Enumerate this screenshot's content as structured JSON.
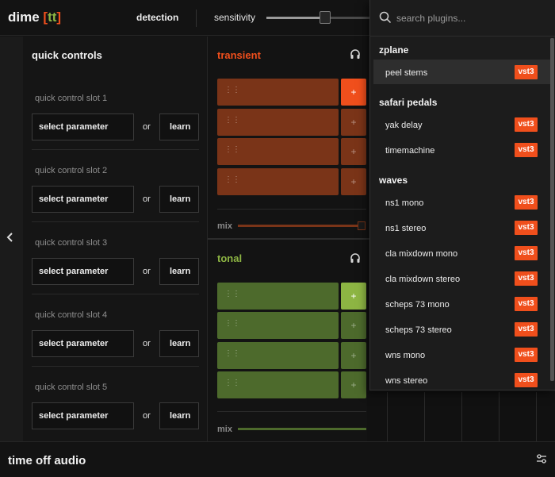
{
  "header": {
    "logo": {
      "name": "dime",
      "open": "[",
      "tt": "tt",
      "close": "]"
    },
    "detection_tab": "detection",
    "sensitivity_label": "sensitivity",
    "sensitivity_value": 0.56
  },
  "left_strip": {
    "collapse_icon": "chevron-left-icon"
  },
  "quick_controls": {
    "title": "quick controls",
    "or_text": "or",
    "slots": [
      {
        "label": "quick control slot 1",
        "param": "select parameter",
        "learn": "learn"
      },
      {
        "label": "quick control slot 2",
        "param": "select parameter",
        "learn": "learn"
      },
      {
        "label": "quick control slot 3",
        "param": "select parameter",
        "learn": "learn"
      },
      {
        "label": "quick control slot 4",
        "param": "select parameter",
        "learn": "learn"
      },
      {
        "label": "quick control slot 5",
        "param": "select parameter",
        "learn": "learn"
      }
    ]
  },
  "transient": {
    "title": "transient",
    "mix_label": "mix",
    "mix_value": 1.0,
    "add_label": "+",
    "headphone_icon": "headphones-icon",
    "color": "#f04f1c",
    "band_color": "#7a3418"
  },
  "tonal": {
    "title": "tonal",
    "mix_label": "mix",
    "mix_value": 1.0,
    "add_label": "+",
    "headphone_icon": "headphones-icon",
    "color": "#8db543",
    "band_color": "#4d6a2c"
  },
  "footer": {
    "brand": "time off audio",
    "settings_icon": "sliders-icon"
  },
  "plugin_browser": {
    "search_placeholder": "search plugins...",
    "search_icon": "search-icon",
    "badge": "vst3",
    "vendors": [
      {
        "name": "zplane",
        "plugins": [
          "peel stems"
        ]
      },
      {
        "name": "safari pedals",
        "plugins": [
          "yak delay",
          "timemachine"
        ]
      },
      {
        "name": "waves",
        "plugins": [
          "ns1 mono",
          "ns1 stereo",
          "cla mixdown mono",
          "cla mixdown stereo",
          "scheps 73 mono",
          "scheps 73 stereo",
          "wns mono",
          "wns stereo"
        ]
      }
    ],
    "selected": "peel stems"
  }
}
